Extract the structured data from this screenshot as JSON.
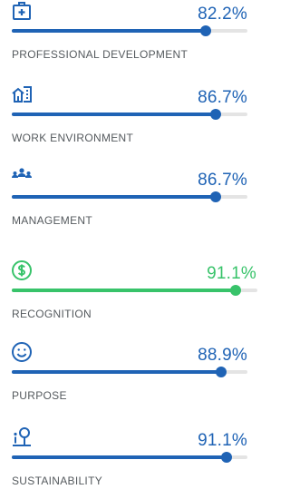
{
  "colors": {
    "blue": "#1f63b5",
    "green": "#38c36a",
    "track": "#e4e4e4",
    "label": "#555a5e"
  },
  "metrics": [
    {
      "icon": "medical-kit-icon",
      "value": "82.2%",
      "fill_percent": 82.2,
      "label": "PROFESSIONAL DEVELOPMENT",
      "accent": "blue"
    },
    {
      "icon": "home-building-icon",
      "value": "86.7%",
      "fill_percent": 86.7,
      "label": "WORK ENVIRONMENT",
      "accent": "blue"
    },
    {
      "icon": "team-icon",
      "value": "86.7%",
      "fill_percent": 86.7,
      "label": "MANAGEMENT",
      "accent": "blue"
    },
    {
      "icon": "dollar-circle-icon",
      "value": "91.1%",
      "fill_percent": 91.1,
      "label": "RECOGNITION",
      "accent": "green"
    },
    {
      "icon": "smiley-icon",
      "value": "88.9%",
      "fill_percent": 88.9,
      "label": "PURPOSE",
      "accent": "blue"
    },
    {
      "icon": "sustainability-person-icon",
      "value": "91.1%",
      "fill_percent": 91.1,
      "label": "SUSTAINABILITY",
      "accent": "blue"
    }
  ]
}
